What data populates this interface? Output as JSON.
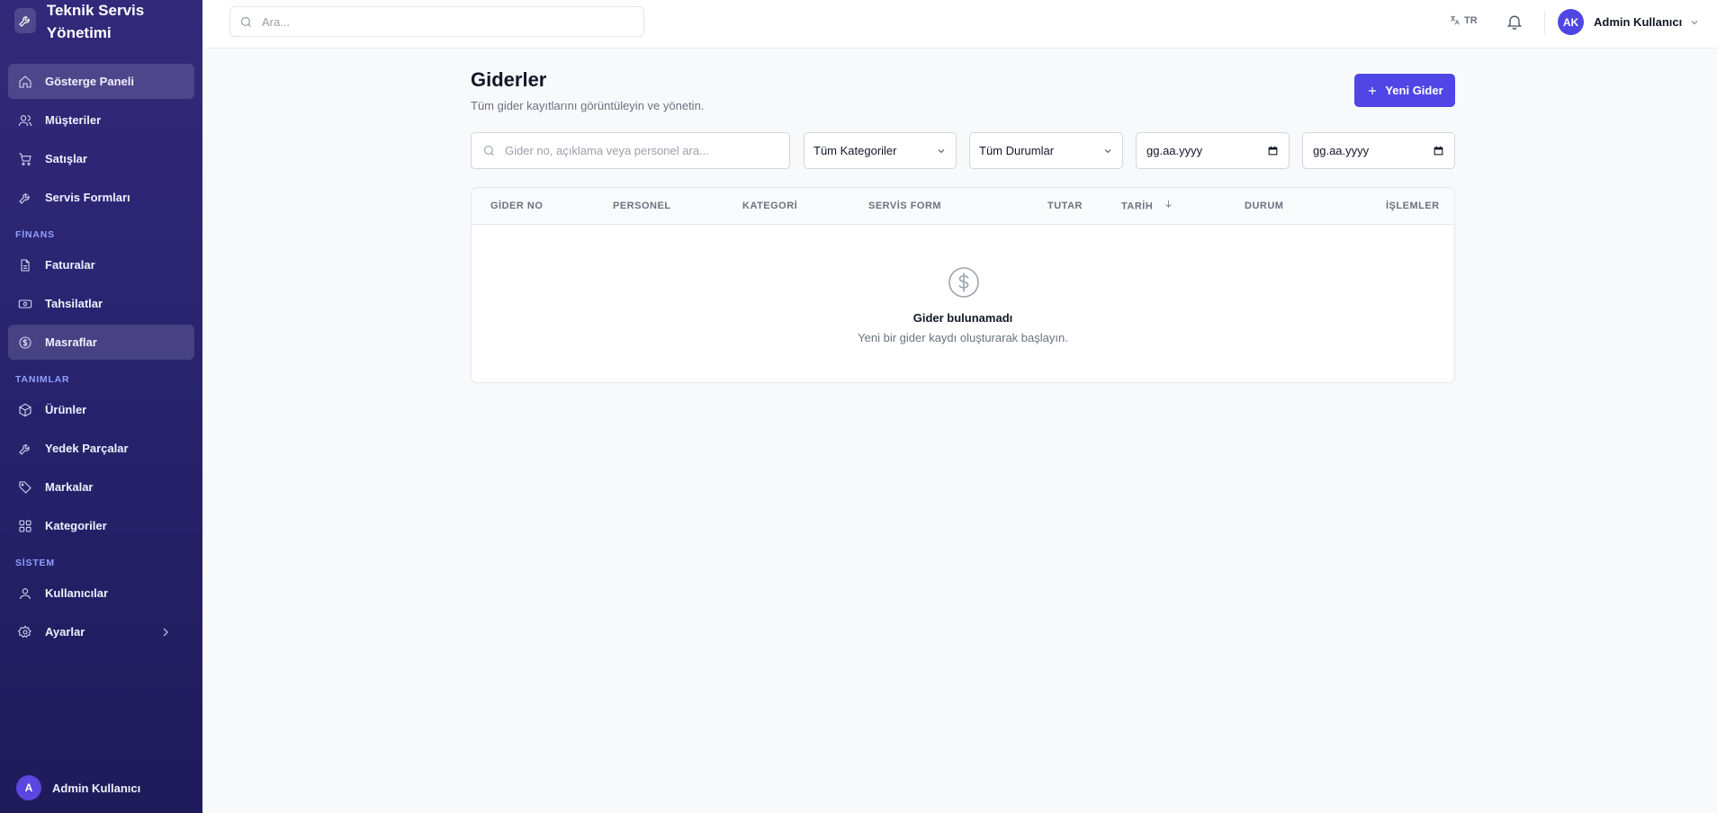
{
  "app": {
    "title": "Teknik Servis Yönetimi"
  },
  "sidebar": {
    "items_main": [
      {
        "label": "Gösterge Paneli",
        "icon": "home-icon"
      },
      {
        "label": "Müşteriler",
        "icon": "users-icon"
      },
      {
        "label": "Satışlar",
        "icon": "cart-icon"
      },
      {
        "label": "Servis Formları",
        "icon": "wrench-icon"
      }
    ],
    "section_finance": "FİNANS",
    "items_finance": [
      {
        "label": "Faturalar",
        "icon": "file-icon"
      },
      {
        "label": "Tahsilatlar",
        "icon": "banknote-icon"
      },
      {
        "label": "Masraflar",
        "icon": "dollar-circle-icon"
      }
    ],
    "section_definitions": "TANIMLAR",
    "items_definitions": [
      {
        "label": "Ürünler",
        "icon": "box-icon"
      },
      {
        "label": "Yedek Parçalar",
        "icon": "wrench-icon"
      },
      {
        "label": "Markalar",
        "icon": "tag-icon"
      },
      {
        "label": "Kategoriler",
        "icon": "grid-icon"
      }
    ],
    "section_system": "SİSTEM",
    "items_system": [
      {
        "label": "Kullanıcılar",
        "icon": "user-icon"
      },
      {
        "label": "Ayarlar",
        "icon": "gear-icon"
      }
    ],
    "user": {
      "initial": "A",
      "name": "Admin Kullanıcı"
    }
  },
  "topbar": {
    "search_placeholder": "Ara...",
    "language": "TR",
    "user_initials": "AK",
    "user_name": "Admin Kullanıcı"
  },
  "page": {
    "title": "Giderler",
    "subtitle": "Tüm gider kayıtlarını görüntüleyin ve yönetin.",
    "new_button": "Yeni Gider"
  },
  "filters": {
    "search_placeholder": "Gider no, açıklama veya personel ara...",
    "category": "Tüm Kategoriler",
    "status": "Tüm Durumlar",
    "date_from": "gg.aa.yyyy",
    "date_to": "gg.aa.yyyy"
  },
  "table": {
    "columns": [
      "GİDER NO",
      "PERSONEL",
      "KATEGORİ",
      "SERVİS FORM",
      "TUTAR",
      "TARİH",
      "DURUM",
      "İŞLEMLER"
    ],
    "empty_title": "Gider bulunamadı",
    "empty_sub": "Yeni bir gider kaydı oluşturarak başlayın."
  },
  "colors": {
    "accent": "#4f46e5",
    "sidebar": "#2a2470"
  }
}
